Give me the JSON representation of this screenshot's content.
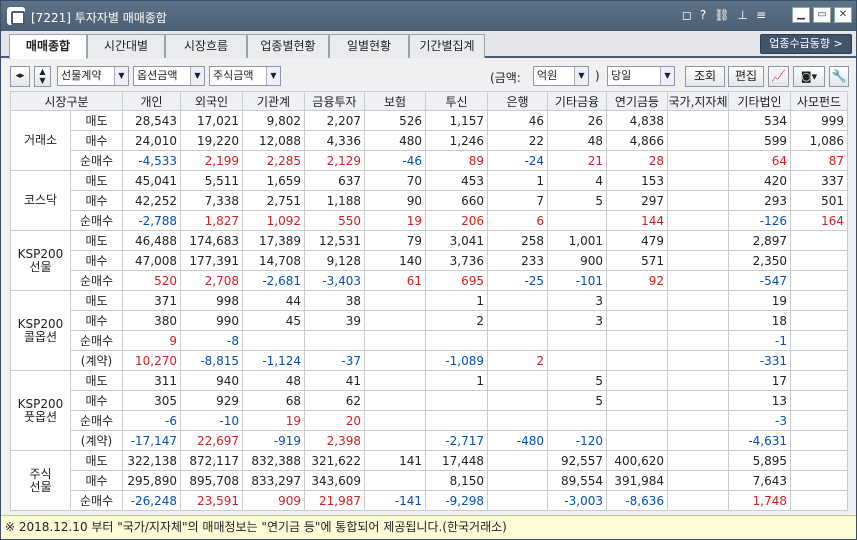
{
  "window": {
    "title": "[7221] 투자자별 매매종합"
  },
  "tabs": [
    "매매종합",
    "시간대별",
    "시장흐름",
    "업종별현황",
    "일별현황",
    "기간별집계"
  ],
  "supply_button": "업종수급동향 >",
  "toolbar": {
    "select1": "선물계약",
    "select2": "옵션금액",
    "select3": "주식금액",
    "amount_label": "(금액:",
    "unit": "억원",
    "paren_close": ")",
    "period": "당일",
    "query": "조회",
    "edit": "편집"
  },
  "headers": [
    "시장구분",
    "개인",
    "외국인",
    "기관계",
    "금융투자",
    "보험",
    "투신",
    "은행",
    "기타금융",
    "연기금등",
    "국가,지자체",
    "기타법인",
    "사모펀드"
  ],
  "groups": [
    {
      "name": "거래소",
      "rows": [
        {
          "label": "매도",
          "values": [
            "28,543",
            "17,021",
            "9,802",
            "2,207",
            "526",
            "1,157",
            "46",
            "26",
            "4,838",
            "",
            "534",
            "999"
          ]
        },
        {
          "label": "매수",
          "values": [
            "24,010",
            "19,220",
            "12,088",
            "4,336",
            "480",
            "1,246",
            "22",
            "48",
            "4,866",
            "",
            "599",
            "1,086"
          ]
        },
        {
          "label": "순매수",
          "values": [
            "-4,533",
            "2,199",
            "2,285",
            "2,129",
            "-46",
            "89",
            "-24",
            "21",
            "28",
            "",
            "64",
            "87"
          ]
        }
      ]
    },
    {
      "name": "코스닥",
      "rows": [
        {
          "label": "매도",
          "values": [
            "45,041",
            "5,511",
            "1,659",
            "637",
            "70",
            "453",
            "1",
            "4",
            "153",
            "",
            "420",
            "337"
          ]
        },
        {
          "label": "매수",
          "values": [
            "42,252",
            "7,338",
            "2,751",
            "1,188",
            "90",
            "660",
            "7",
            "5",
            "297",
            "",
            "293",
            "501"
          ]
        },
        {
          "label": "순매수",
          "values": [
            "-2,788",
            "1,827",
            "1,092",
            "550",
            "19",
            "206",
            "6",
            "",
            "144",
            "",
            "-126",
            "164"
          ]
        }
      ]
    },
    {
      "name": "KSP200\n선물",
      "rows": [
        {
          "label": "매도",
          "values": [
            "46,488",
            "174,683",
            "17,389",
            "12,531",
            "79",
            "3,041",
            "258",
            "1,001",
            "479",
            "",
            "2,897",
            ""
          ]
        },
        {
          "label": "매수",
          "values": [
            "47,008",
            "177,391",
            "14,708",
            "9,128",
            "140",
            "3,736",
            "233",
            "900",
            "571",
            "",
            "2,350",
            ""
          ]
        },
        {
          "label": "순매수",
          "values": [
            "520",
            "2,708",
            "-2,681",
            "-3,403",
            "61",
            "695",
            "-25",
            "-101",
            "92",
            "",
            "-547",
            ""
          ]
        }
      ]
    },
    {
      "name": "KSP200\n콜옵션",
      "rows": [
        {
          "label": "매도",
          "values": [
            "371",
            "998",
            "44",
            "38",
            "",
            "1",
            "",
            "3",
            "",
            "",
            "19",
            ""
          ]
        },
        {
          "label": "매수",
          "values": [
            "380",
            "990",
            "45",
            "39",
            "",
            "2",
            "",
            "3",
            "",
            "",
            "18",
            ""
          ]
        },
        {
          "label": "순매수",
          "values": [
            "9",
            "-8",
            "",
            "",
            "",
            "",
            "",
            "",
            "",
            "",
            "-1",
            ""
          ]
        },
        {
          "label": "(계약)",
          "values": [
            "10,270",
            "-8,815",
            "-1,124",
            "-37",
            "",
            "-1,089",
            "2",
            "",
            "",
            "",
            "-331",
            ""
          ]
        }
      ]
    },
    {
      "name": "KSP200\n풋옵션",
      "rows": [
        {
          "label": "매도",
          "values": [
            "311",
            "940",
            "48",
            "41",
            "",
            "1",
            "",
            "5",
            "",
            "",
            "17",
            ""
          ]
        },
        {
          "label": "매수",
          "values": [
            "305",
            "929",
            "68",
            "62",
            "",
            "",
            "",
            "5",
            "",
            "",
            "13",
            ""
          ]
        },
        {
          "label": "순매수",
          "values": [
            "-6",
            "-10",
            "19",
            "20",
            "",
            "",
            "",
            "",
            "",
            "",
            "-3",
            ""
          ]
        },
        {
          "label": "(계약)",
          "values": [
            "-17,147",
            "22,697",
            "-919",
            "2,398",
            "",
            "-2,717",
            "-480",
            "-120",
            "",
            "",
            "-4,631",
            ""
          ]
        }
      ]
    },
    {
      "name": "주식\n선물",
      "rows": [
        {
          "label": "매도",
          "values": [
            "322,138",
            "872,117",
            "832,388",
            "321,622",
            "141",
            "17,448",
            "",
            "92,557",
            "400,620",
            "",
            "5,895",
            ""
          ]
        },
        {
          "label": "매수",
          "values": [
            "295,890",
            "895,708",
            "833,297",
            "343,609",
            "",
            "8,150",
            "",
            "89,554",
            "391,984",
            "",
            "7,643",
            ""
          ]
        },
        {
          "label": "순매수",
          "values": [
            "-26,248",
            "23,591",
            "909",
            "21,987",
            "-141",
            "-9,298",
            "",
            "-3,003",
            "-8,636",
            "",
            "1,748",
            ""
          ]
        }
      ]
    }
  ],
  "notice": "※ 2018.12.10 부터 \"국가/지자체\"의 매매정보는 \"연기금 등\"에 통합되어 제공됩니다.(한국거래소)",
  "colors": {
    "positive": "#d21e1e",
    "negative": "#0050b4",
    "titlebar": "#4a5f74"
  }
}
